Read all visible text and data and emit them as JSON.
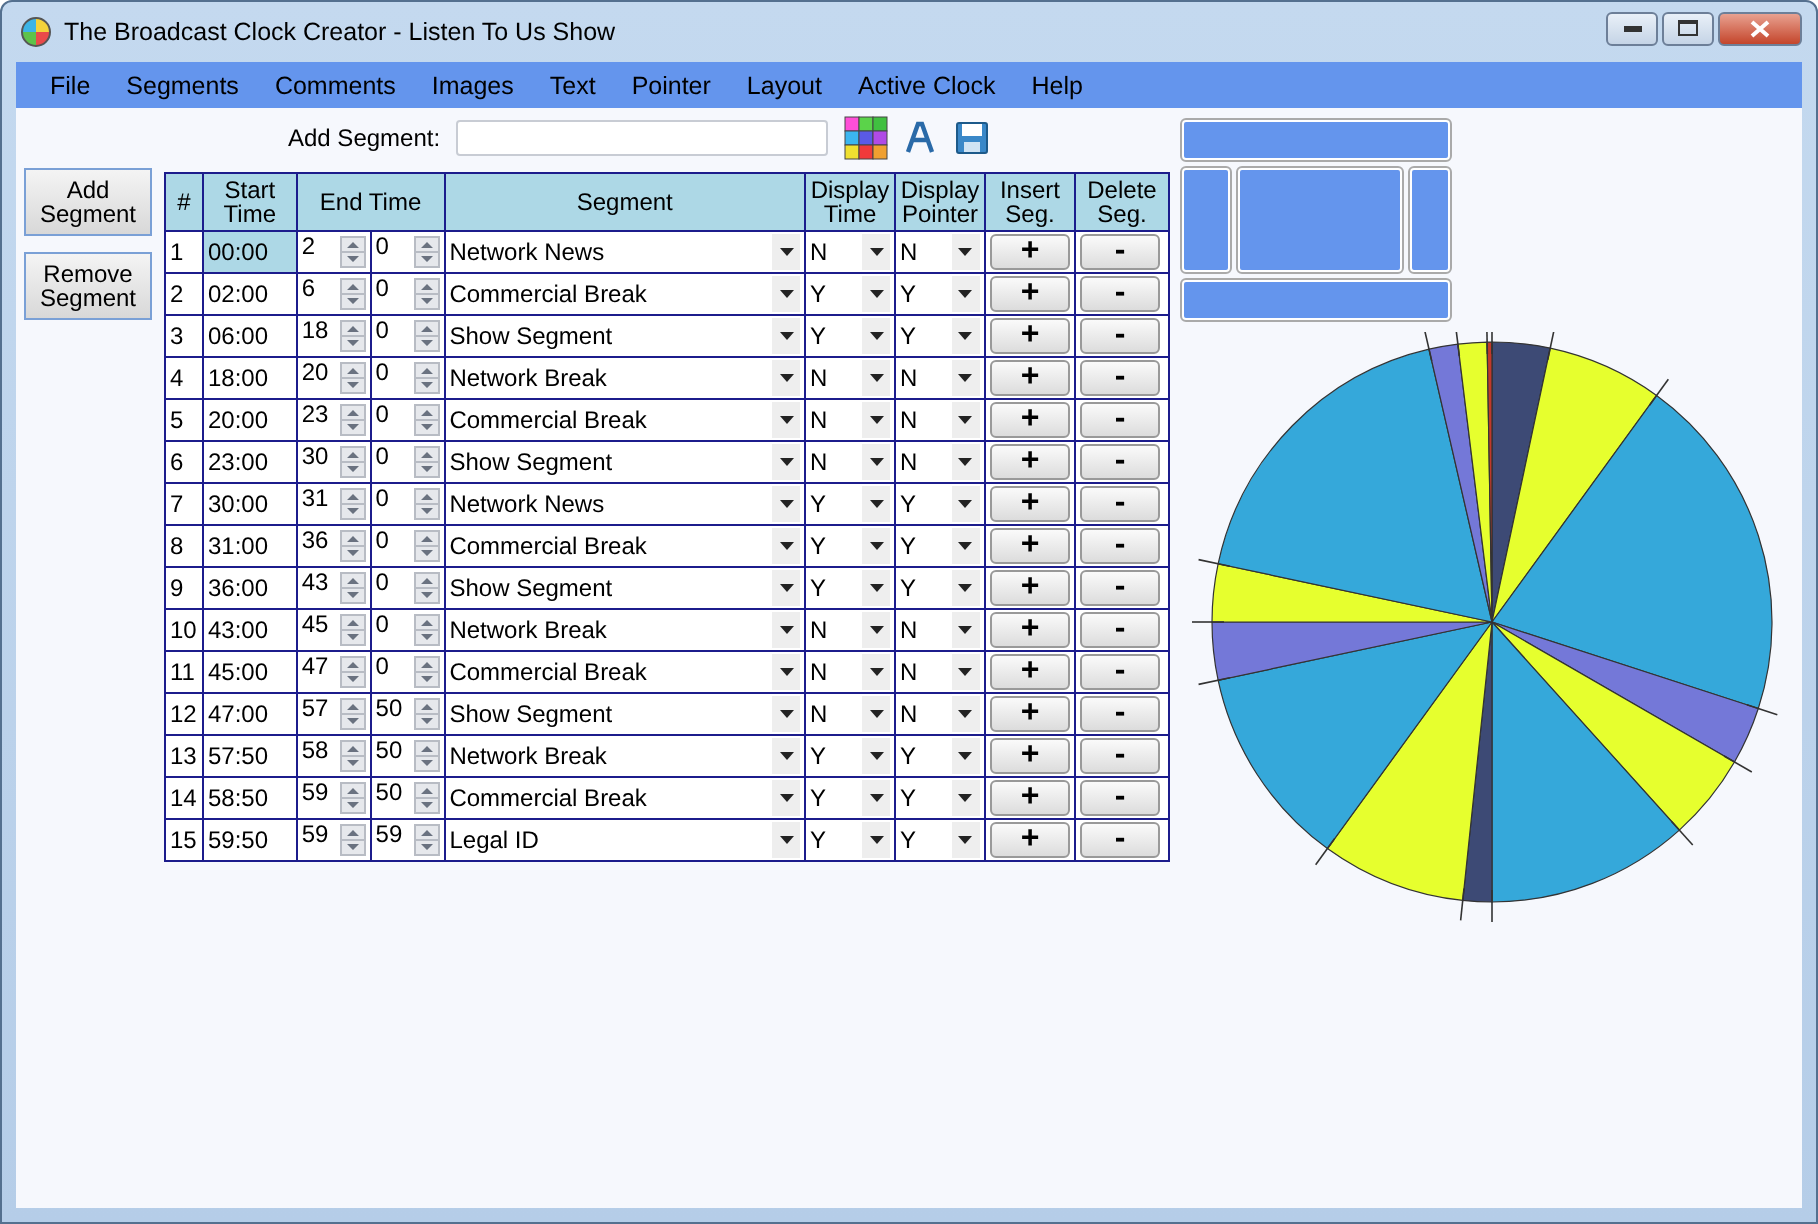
{
  "window": {
    "title": "The Broadcast Clock Creator - Listen To Us Show"
  },
  "menu": [
    "File",
    "Segments",
    "Comments",
    "Images",
    "Text",
    "Pointer",
    "Layout",
    "Active Clock",
    "Help"
  ],
  "add_segment": {
    "label": "Add Segment:"
  },
  "clock": {
    "slices": [
      {
        "color": "#3d4a75"
      },
      {
        "color": "#e6ff2e"
      },
      {
        "color": "#35a8da"
      },
      {
        "color": "#7478d8"
      },
      {
        "color": "#e6ff2e"
      },
      {
        "color": "#35a8da"
      },
      {
        "color": "#3d4a75"
      },
      {
        "color": "#e6ff2e"
      },
      {
        "color": "#35a8da"
      },
      {
        "color": "#7478d8"
      },
      {
        "color": "#e6ff2e"
      },
      {
        "color": "#35a8da"
      },
      {
        "color": "#7478d8"
      },
      {
        "color": "#e6ff2e"
      },
      {
        "color": "#c0392b"
      }
    ]
  },
  "side_buttons": [
    "Add Segment",
    "Remove Segment"
  ],
  "table": {
    "columns": [
      "#",
      "Start Time",
      "End Time",
      "Segment",
      "Display Time",
      "Display Pointer",
      "Insert Seg.",
      "Delete Seg."
    ],
    "rows": [
      {
        "num": "1",
        "start": "00:00",
        "end_min": "2",
        "end_sec": "0",
        "segment": "Network News",
        "display_time": "N",
        "display_pointer": "N",
        "insert": "+",
        "delete": "-",
        "selected": true
      },
      {
        "num": "2",
        "start": "02:00",
        "end_min": "6",
        "end_sec": "0",
        "segment": "Commercial Break",
        "display_time": "Y",
        "display_pointer": "Y",
        "insert": "+",
        "delete": "-",
        "selected": false
      },
      {
        "num": "3",
        "start": "06:00",
        "end_min": "18",
        "end_sec": "0",
        "segment": "Show Segment",
        "display_time": "Y",
        "display_pointer": "Y",
        "insert": "+",
        "delete": "-",
        "selected": false
      },
      {
        "num": "4",
        "start": "18:00",
        "end_min": "20",
        "end_sec": "0",
        "segment": "Network Break",
        "display_time": "N",
        "display_pointer": "N",
        "insert": "+",
        "delete": "-",
        "selected": false
      },
      {
        "num": "5",
        "start": "20:00",
        "end_min": "23",
        "end_sec": "0",
        "segment": "Commercial Break",
        "display_time": "N",
        "display_pointer": "N",
        "insert": "+",
        "delete": "-",
        "selected": false
      },
      {
        "num": "6",
        "start": "23:00",
        "end_min": "30",
        "end_sec": "0",
        "segment": "Show Segment",
        "display_time": "N",
        "display_pointer": "N",
        "insert": "+",
        "delete": "-",
        "selected": false
      },
      {
        "num": "7",
        "start": "30:00",
        "end_min": "31",
        "end_sec": "0",
        "segment": "Network News",
        "display_time": "Y",
        "display_pointer": "Y",
        "insert": "+",
        "delete": "-",
        "selected": false
      },
      {
        "num": "8",
        "start": "31:00",
        "end_min": "36",
        "end_sec": "0",
        "segment": "Commercial Break",
        "display_time": "Y",
        "display_pointer": "Y",
        "insert": "+",
        "delete": "-",
        "selected": false
      },
      {
        "num": "9",
        "start": "36:00",
        "end_min": "43",
        "end_sec": "0",
        "segment": "Show Segment",
        "display_time": "Y",
        "display_pointer": "Y",
        "insert": "+",
        "delete": "-",
        "selected": false
      },
      {
        "num": "10",
        "start": "43:00",
        "end_min": "45",
        "end_sec": "0",
        "segment": "Network Break",
        "display_time": "N",
        "display_pointer": "N",
        "insert": "+",
        "delete": "-",
        "selected": false
      },
      {
        "num": "11",
        "start": "45:00",
        "end_min": "47",
        "end_sec": "0",
        "segment": "Commercial Break",
        "display_time": "N",
        "display_pointer": "N",
        "insert": "+",
        "delete": "-",
        "selected": false
      },
      {
        "num": "12",
        "start": "47:00",
        "end_min": "57",
        "end_sec": "50",
        "segment": "Show Segment",
        "display_time": "N",
        "display_pointer": "N",
        "insert": "+",
        "delete": "-",
        "selected": false
      },
      {
        "num": "13",
        "start": "57:50",
        "end_min": "58",
        "end_sec": "50",
        "segment": "Network Break",
        "display_time": "Y",
        "display_pointer": "Y",
        "insert": "+",
        "delete": "-",
        "selected": false
      },
      {
        "num": "14",
        "start": "58:50",
        "end_min": "59",
        "end_sec": "50",
        "segment": "Commercial Break",
        "display_time": "Y",
        "display_pointer": "Y",
        "insert": "+",
        "delete": "-",
        "selected": false
      },
      {
        "num": "15",
        "start": "59:50",
        "end_min": "59",
        "end_sec": "59",
        "segment": "Legal ID",
        "display_time": "Y",
        "display_pointer": "Y",
        "insert": "+",
        "delete": "-",
        "selected": false
      }
    ]
  }
}
